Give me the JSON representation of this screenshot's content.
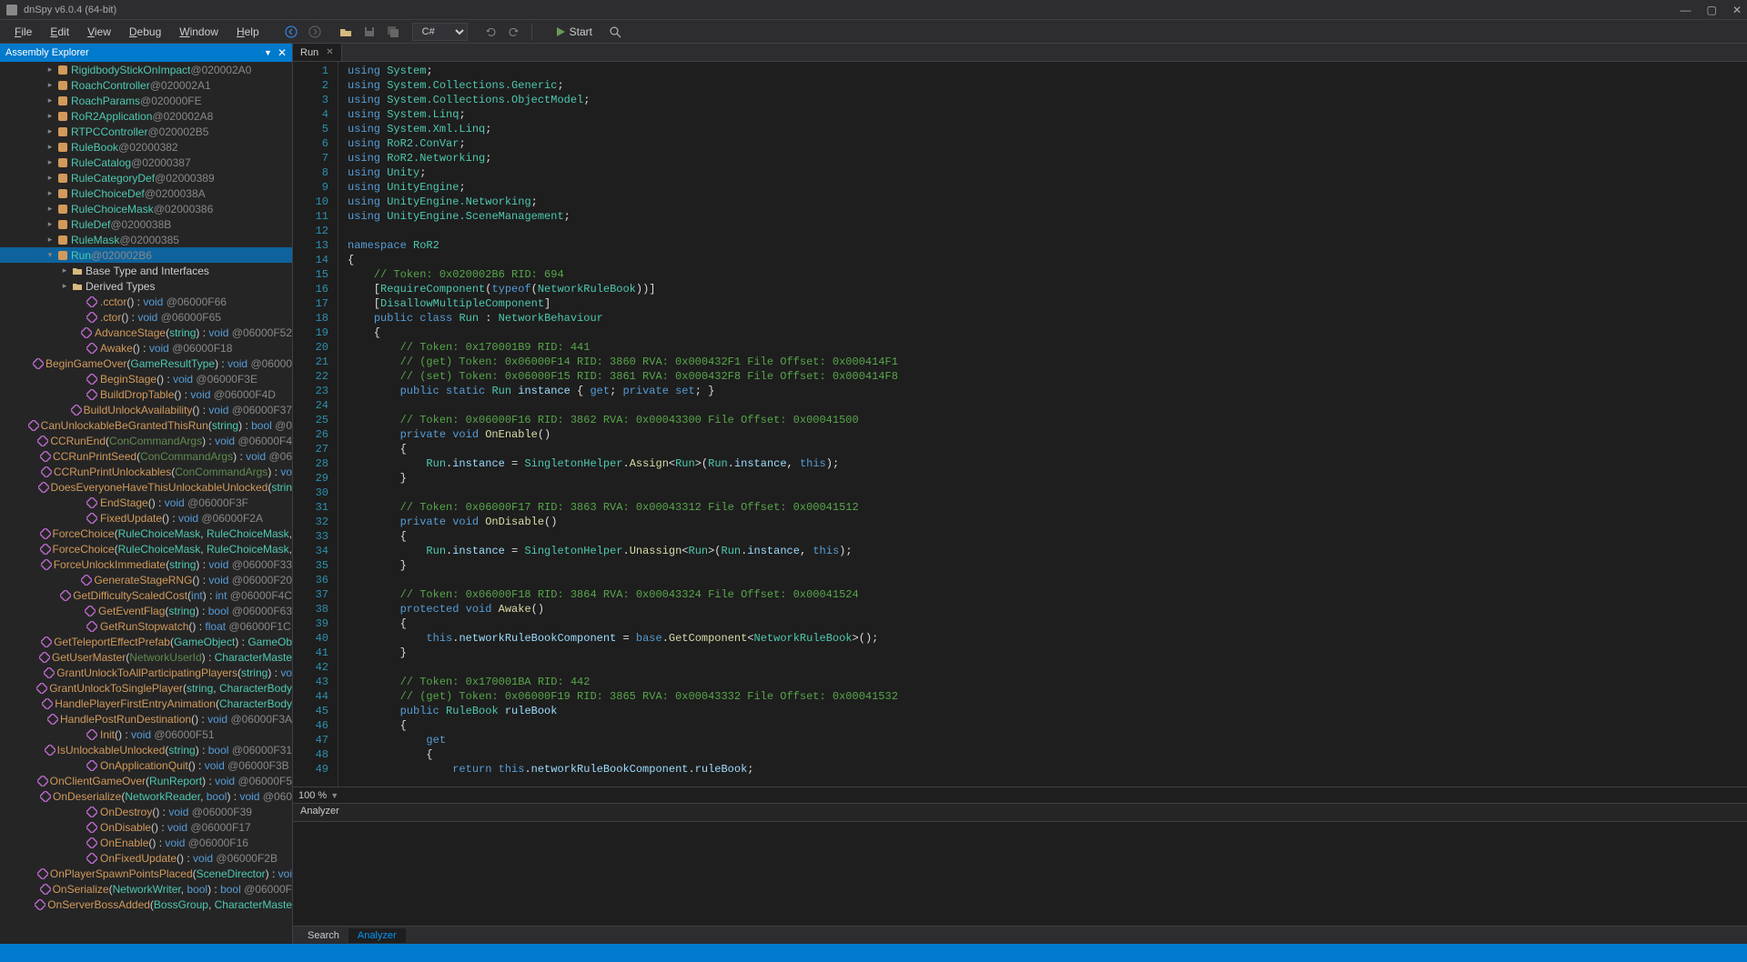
{
  "title": "dnSpy v6.0.4 (64-bit)",
  "menu": [
    "File",
    "Edit",
    "View",
    "Debug",
    "Window",
    "Help"
  ],
  "toolbar": {
    "language": "C#",
    "start": "Start"
  },
  "sidebar": {
    "title": "Assembly Explorer",
    "items": [
      {
        "indent": 3,
        "caret": ">",
        "icon": "class",
        "label": "RigidbodyStickOnImpact",
        "suffix": " @020002A0",
        "cls": "c-class"
      },
      {
        "indent": 3,
        "caret": ">",
        "icon": "class",
        "label": "RoachController",
        "suffix": " @020002A1",
        "cls": "c-class"
      },
      {
        "indent": 3,
        "caret": ">",
        "icon": "class",
        "label": "RoachParams",
        "suffix": " @020000FE",
        "cls": "c-class"
      },
      {
        "indent": 3,
        "caret": ">",
        "icon": "class",
        "label": "RoR2Application",
        "suffix": " @020002A8",
        "cls": "c-class"
      },
      {
        "indent": 3,
        "caret": ">",
        "icon": "class",
        "label": "RTPCController",
        "suffix": " @020002B5",
        "cls": "c-class"
      },
      {
        "indent": 3,
        "caret": ">",
        "icon": "class",
        "label": "RuleBook",
        "suffix": " @02000382",
        "cls": "c-class"
      },
      {
        "indent": 3,
        "caret": ">",
        "icon": "class",
        "label": "RuleCatalog",
        "suffix": " @02000387",
        "cls": "c-class"
      },
      {
        "indent": 3,
        "caret": ">",
        "icon": "class",
        "label": "RuleCategoryDef",
        "suffix": " @02000389",
        "cls": "c-class"
      },
      {
        "indent": 3,
        "caret": ">",
        "icon": "class",
        "label": "RuleChoiceDef",
        "suffix": " @0200038A",
        "cls": "c-class"
      },
      {
        "indent": 3,
        "caret": ">",
        "icon": "class",
        "label": "RuleChoiceMask",
        "suffix": " @02000386",
        "cls": "c-class"
      },
      {
        "indent": 3,
        "caret": ">",
        "icon": "class",
        "label": "RuleDef",
        "suffix": " @0200038B",
        "cls": "c-class"
      },
      {
        "indent": 3,
        "caret": ">",
        "icon": "class",
        "label": "RuleMask",
        "suffix": " @02000385",
        "cls": "c-class"
      },
      {
        "indent": 3,
        "caret": "v",
        "icon": "class",
        "label": "Run",
        "suffix": " @020002B6",
        "cls": "c-class",
        "selected": true
      },
      {
        "indent": 4,
        "caret": ">",
        "icon": "folder",
        "label": "Base Type and Interfaces",
        "suffix": "",
        "cls": ""
      },
      {
        "indent": 4,
        "caret": ">",
        "icon": "folder",
        "label": "Derived Types",
        "suffix": "",
        "cls": ""
      },
      {
        "indent": 5,
        "caret": "",
        "icon": "method",
        "html": "<span class='c-method'>.cctor</span>() : <span class='c-void'>void</span> <span class='c-at'>@06000F66</span>"
      },
      {
        "indent": 5,
        "caret": "",
        "icon": "method",
        "html": "<span class='c-method'>.ctor</span>() : <span class='c-void'>void</span> <span class='c-at'>@06000F65</span>"
      },
      {
        "indent": 5,
        "caret": "",
        "icon": "method",
        "html": "<span class='c-method'>AdvanceStage</span>(<span class='c-type'>string</span>) : <span class='c-void'>void</span> <span class='c-at'>@06000F52</span>"
      },
      {
        "indent": 5,
        "caret": "",
        "icon": "method",
        "html": "<span class='c-method'>Awake</span>() : <span class='c-void'>void</span> <span class='c-at'>@06000F18</span>"
      },
      {
        "indent": 5,
        "caret": "",
        "icon": "method",
        "html": "<span class='c-method'>BeginGameOver</span>(<span class='c-type'>GameResultType</span>) : <span class='c-void'>void</span> <span class='c-at'>@06000</span>"
      },
      {
        "indent": 5,
        "caret": "",
        "icon": "method",
        "html": "<span class='c-method'>BeginStage</span>() : <span class='c-void'>void</span> <span class='c-at'>@06000F3E</span>"
      },
      {
        "indent": 5,
        "caret": "",
        "icon": "method",
        "html": "<span class='c-method'>BuildDropTable</span>() : <span class='c-void'>void</span> <span class='c-at'>@06000F4D</span>"
      },
      {
        "indent": 5,
        "caret": "",
        "icon": "method",
        "html": "<span class='c-method'>BuildUnlockAvailability</span>() : <span class='c-void'>void</span> <span class='c-at'>@06000F37</span>"
      },
      {
        "indent": 5,
        "caret": "",
        "icon": "method",
        "html": "<span class='c-method'>CanUnlockableBeGrantedThisRun</span>(<span class='c-type'>string</span>) : <span class='c-bool'>bool</span> <span class='c-at'>@0</span>"
      },
      {
        "indent": 5,
        "caret": "",
        "icon": "method",
        "html": "<span class='c-method'>CCRunEnd</span>(<span class='c-green'>ConCommandArgs</span>) : <span class='c-void'>void</span> <span class='c-at'>@06000F4</span>"
      },
      {
        "indent": 5,
        "caret": "",
        "icon": "method",
        "html": "<span class='c-method'>CCRunPrintSeed</span>(<span class='c-green'>ConCommandArgs</span>) : <span class='c-void'>void</span> <span class='c-at'>@06</span>"
      },
      {
        "indent": 5,
        "caret": "",
        "icon": "method",
        "html": "<span class='c-method'>CCRunPrintUnlockables</span>(<span class='c-green'>ConCommandArgs</span>) : <span class='c-void'>vo</span>"
      },
      {
        "indent": 5,
        "caret": "",
        "icon": "method",
        "html": "<span class='c-method'>DoesEveryoneHaveThisUnlockableUnlocked</span>(<span class='c-type'>strin</span>"
      },
      {
        "indent": 5,
        "caret": "",
        "icon": "method",
        "html": "<span class='c-method'>EndStage</span>() : <span class='c-void'>void</span> <span class='c-at'>@06000F3F</span>"
      },
      {
        "indent": 5,
        "caret": "",
        "icon": "method",
        "html": "<span class='c-method'>FixedUpdate</span>() : <span class='c-void'>void</span> <span class='c-at'>@06000F2A</span>"
      },
      {
        "indent": 5,
        "caret": "",
        "icon": "method",
        "html": "<span class='c-method'>ForceChoice</span>(<span class='c-type'>RuleChoiceMask</span>, <span class='c-type'>RuleChoiceMask</span>,"
      },
      {
        "indent": 5,
        "caret": "",
        "icon": "method",
        "html": "<span class='c-method'>ForceChoice</span>(<span class='c-type'>RuleChoiceMask</span>, <span class='c-type'>RuleChoiceMask</span>,"
      },
      {
        "indent": 5,
        "caret": "",
        "icon": "method",
        "html": "<span class='c-method'>ForceUnlockImmediate</span>(<span class='c-type'>string</span>) : <span class='c-void'>void</span> <span class='c-at'>@06000F33</span>"
      },
      {
        "indent": 5,
        "caret": "",
        "icon": "method",
        "html": "<span class='c-method'>GenerateStageRNG</span>() : <span class='c-void'>void</span> <span class='c-at'>@06000F20</span>"
      },
      {
        "indent": 5,
        "caret": "",
        "icon": "method",
        "html": "<span class='c-method'>GetDifficultyScaledCost</span>(<span class='c-bool'>int</span>) : <span class='c-bool'>int</span> <span class='c-at'>@06000F4C</span>"
      },
      {
        "indent": 5,
        "caret": "",
        "icon": "method",
        "html": "<span class='c-method'>GetEventFlag</span>(<span class='c-type'>string</span>) : <span class='c-bool'>bool</span> <span class='c-at'>@06000F63</span>"
      },
      {
        "indent": 5,
        "caret": "",
        "icon": "method",
        "html": "<span class='c-method'>GetRunStopwatch</span>() : <span class='c-bool'>float</span> <span class='c-at'>@06000F1C</span>"
      },
      {
        "indent": 5,
        "caret": "",
        "icon": "method",
        "html": "<span class='c-method'>GetTeleportEffectPrefab</span>(<span class='c-type'>GameObject</span>) : <span class='c-type'>GameOb</span>"
      },
      {
        "indent": 5,
        "caret": "",
        "icon": "method",
        "html": "<span class='c-method'>GetUserMaster</span>(<span class='c-green'>NetworkUserId</span>) : <span class='c-type'>CharacterMaste</span>"
      },
      {
        "indent": 5,
        "caret": "",
        "icon": "method",
        "html": "<span class='c-method'>GrantUnlockToAllParticipatingPlayers</span>(<span class='c-type'>string</span>) : <span class='c-void'>vo</span>"
      },
      {
        "indent": 5,
        "caret": "",
        "icon": "method",
        "html": "<span class='c-method'>GrantUnlockToSinglePlayer</span>(<span class='c-type'>string</span>, <span class='c-type'>CharacterBody</span>"
      },
      {
        "indent": 5,
        "caret": "",
        "icon": "method",
        "html": "<span class='c-method'>HandlePlayerFirstEntryAnimation</span>(<span class='c-type'>CharacterBody</span>"
      },
      {
        "indent": 5,
        "caret": "",
        "icon": "method",
        "html": "<span class='c-method'>HandlePostRunDestination</span>() : <span class='c-void'>void</span> <span class='c-at'>@06000F3A</span>"
      },
      {
        "indent": 5,
        "caret": "",
        "icon": "method",
        "html": "<span class='c-method'>Init</span>() : <span class='c-void'>void</span> <span class='c-at'>@06000F51</span>"
      },
      {
        "indent": 5,
        "caret": "",
        "icon": "method",
        "html": "<span class='c-method'>IsUnlockableUnlocked</span>(<span class='c-type'>string</span>) : <span class='c-bool'>bool</span> <span class='c-at'>@06000F31</span>"
      },
      {
        "indent": 5,
        "caret": "",
        "icon": "method",
        "html": "<span class='c-method'>OnApplicationQuit</span>() : <span class='c-void'>void</span> <span class='c-at'>@06000F3B</span>"
      },
      {
        "indent": 5,
        "caret": "",
        "icon": "method",
        "html": "<span class='c-method'>OnClientGameOver</span>(<span class='c-type'>RunReport</span>) : <span class='c-void'>void</span> <span class='c-at'>@06000F5</span>"
      },
      {
        "indent": 5,
        "caret": "",
        "icon": "method",
        "html": "<span class='c-method'>OnDeserialize</span>(<span class='c-type'>NetworkReader</span>, <span class='c-bool'>bool</span>) : <span class='c-void'>void</span> <span class='c-at'>@060</span>"
      },
      {
        "indent": 5,
        "caret": "",
        "icon": "method",
        "html": "<span class='c-method'>OnDestroy</span>() : <span class='c-void'>void</span> <span class='c-at'>@06000F39</span>"
      },
      {
        "indent": 5,
        "caret": "",
        "icon": "method",
        "html": "<span class='c-method'>OnDisable</span>() : <span class='c-void'>void</span> <span class='c-at'>@06000F17</span>"
      },
      {
        "indent": 5,
        "caret": "",
        "icon": "method",
        "html": "<span class='c-method'>OnEnable</span>() : <span class='c-void'>void</span> <span class='c-at'>@06000F16</span>"
      },
      {
        "indent": 5,
        "caret": "",
        "icon": "method",
        "html": "<span class='c-method'>OnFixedUpdate</span>() : <span class='c-void'>void</span> <span class='c-at'>@06000F2B</span>"
      },
      {
        "indent": 5,
        "caret": "",
        "icon": "method",
        "html": "<span class='c-method'>OnPlayerSpawnPointsPlaced</span>(<span class='c-type'>SceneDirector</span>) : <span class='c-void'>voi</span>"
      },
      {
        "indent": 5,
        "caret": "",
        "icon": "method",
        "html": "<span class='c-method'>OnSerialize</span>(<span class='c-type'>NetworkWriter</span>, <span class='c-bool'>bool</span>) : <span class='c-bool'>bool</span> <span class='c-at'>@06000F</span>"
      },
      {
        "indent": 5,
        "caret": "",
        "icon": "method",
        "html": "<span class='c-method'>OnServerBossAdded</span>(<span class='c-type'>BossGroup</span>, <span class='c-type'>CharacterMaste</span>"
      }
    ]
  },
  "editor": {
    "tab": "Run",
    "zoom": "100 %",
    "lines": [
      "<span class='k-key'>using</span> <span class='k-type'>System</span>;",
      "<span class='k-key'>using</span> <span class='k-type'>System.Collections.Generic</span>;",
      "<span class='k-key'>using</span> <span class='k-type'>System.Collections.ObjectModel</span>;",
      "<span class='k-key'>using</span> <span class='k-type'>System.Linq</span>;",
      "<span class='k-key'>using</span> <span class='k-type'>System.Xml.Linq</span>;",
      "<span class='k-key'>using</span> <span class='k-type'>RoR2.ConVar</span>;",
      "<span class='k-key'>using</span> <span class='k-type'>RoR2.Networking</span>;",
      "<span class='k-key'>using</span> <span class='k-type'>Unity</span>;",
      "<span class='k-key'>using</span> <span class='k-type'>UnityEngine</span>;",
      "<span class='k-key'>using</span> <span class='k-type'>UnityEngine.Networking</span>;",
      "<span class='k-key'>using</span> <span class='k-type'>UnityEngine.SceneManagement</span>;",
      "",
      "<span class='k-key'>namespace</span> <span class='k-type'>RoR2</span>",
      "{",
      "    <span class='k-comment'>// Token: 0x020002B6 RID: 694</span>",
      "    [<span class='k-attr'>RequireComponent</span>(<span class='k-key'>typeof</span>(<span class='k-type'>NetworkRuleBook</span>))]",
      "    [<span class='k-attr'>DisallowMultipleComponent</span>]",
      "    <span class='k-key'>public class</span> <span class='k-type'>Run</span> : <span class='k-type'>NetworkBehaviour</span>",
      "    {",
      "        <span class='k-comment'>// Token: 0x170001B9 RID: 441</span>",
      "        <span class='k-comment'>// (get) Token: 0x06000F14 RID: 3860 RVA: 0x000432F1 File Offset: 0x000414F1</span>",
      "        <span class='k-comment'>// (set) Token: 0x06000F15 RID: 3861 RVA: 0x000432F8 File Offset: 0x000414F8</span>",
      "        <span class='k-key'>public static</span> <span class='k-type'>Run</span> <span class='k-field'>instance</span> { <span class='k-key'>get</span>; <span class='k-key'>private set</span>; }",
      "",
      "        <span class='k-comment'>// Token: 0x06000F16 RID: 3862 RVA: 0x00043300 File Offset: 0x00041500</span>",
      "        <span class='k-key'>private void</span> <span class='k-method'>OnEnable</span>()",
      "        {",
      "            <span class='k-type'>Run</span>.<span class='k-field'>instance</span> = <span class='k-type'>SingletonHelper</span>.<span class='k-method'>Assign</span>&lt;<span class='k-type'>Run</span>&gt;(<span class='k-type'>Run</span>.<span class='k-field'>instance</span>, <span class='k-key'>this</span>);",
      "        }",
      "",
      "        <span class='k-comment'>// Token: 0x06000F17 RID: 3863 RVA: 0x00043312 File Offset: 0x00041512</span>",
      "        <span class='k-key'>private void</span> <span class='k-method'>OnDisable</span>()",
      "        {",
      "            <span class='k-type'>Run</span>.<span class='k-field'>instance</span> = <span class='k-type'>SingletonHelper</span>.<span class='k-method'>Unassign</span>&lt;<span class='k-type'>Run</span>&gt;(<span class='k-type'>Run</span>.<span class='k-field'>instance</span>, <span class='k-key'>this</span>);",
      "        }",
      "",
      "        <span class='k-comment'>// Token: 0x06000F18 RID: 3864 RVA: 0x00043324 File Offset: 0x00041524</span>",
      "        <span class='k-key'>protected void</span> <span class='k-method'>Awake</span>()",
      "        {",
      "            <span class='k-key'>this</span>.<span class='k-field'>networkRuleBookComponent</span> = <span class='k-key'>base</span>.<span class='k-method'>GetComponent</span>&lt;<span class='k-type'>NetworkRuleBook</span>&gt;();",
      "        }",
      "",
      "        <span class='k-comment'>// Token: 0x170001BA RID: 442</span>",
      "        <span class='k-comment'>// (get) Token: 0x06000F19 RID: 3865 RVA: 0x00043332 File Offset: 0x00041532</span>",
      "        <span class='k-key'>public</span> <span class='k-type'>RuleBook</span> <span class='k-field'>ruleBook</span>",
      "        {",
      "            <span class='k-key'>get</span>",
      "            {",
      "                <span class='k-key'>return this</span>.<span class='k-field'>networkRuleBookComponent</span>.<span class='k-field'>ruleBook</span>;"
    ]
  },
  "analyzer": {
    "title": "Analyzer"
  },
  "bottomTabs": {
    "search": "Search",
    "analyzer": "Analyzer"
  }
}
